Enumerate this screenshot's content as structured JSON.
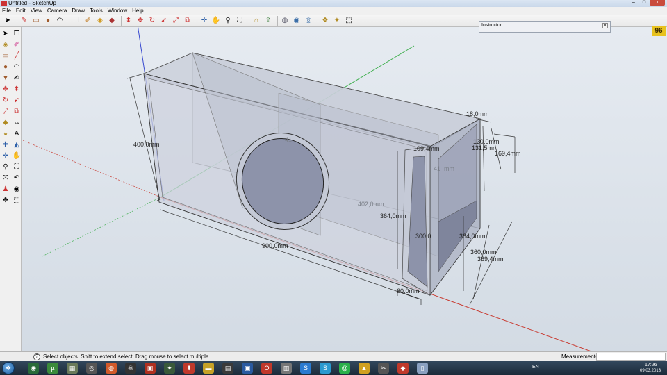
{
  "window": {
    "title": "Untitled - SketchUp",
    "minimize": "–",
    "maximize": "□",
    "close": "x"
  },
  "menu": [
    "File",
    "Edit",
    "View",
    "Camera",
    "Draw",
    "Tools",
    "Window",
    "Help"
  ],
  "instructor": {
    "title": "Instructor",
    "close": "x"
  },
  "badge": "96",
  "dimensions": {
    "height_left": "400,0mm",
    "length_bottom": "900,0mm",
    "inner_height": "364,0mm",
    "width_bottom": "60,0mm",
    "right_height_1": "360,0mm",
    "right_height_2": "369,4mm",
    "top_width": "18,0mm",
    "top_right_1": "130,0mm",
    "top_right_2": "131,5mm",
    "top_right_3": "169,4mm",
    "panel_width": "109,4mm",
    "inner_label_1": "41",
    "inner_label_2": "41",
    "inner_label_3": "mm",
    "inner_depth": "402,0mm",
    "inner_small_1": "300,0",
    "inner_small_2": "364,0mm"
  },
  "status": {
    "hint": "Select objects. Shift to extend select. Drag mouse to select multiple.",
    "measurements_label": "Measurements",
    "measurements_value": ""
  },
  "tray": {
    "lang": "EN",
    "time": "17:26",
    "date": "09.03.2013"
  },
  "colors": {
    "axis_red": "#c8392f",
    "axis_green": "#3cae4b",
    "axis_blue": "#3a4bd0",
    "box_face": "#c9ceda",
    "box_dark": "#9da3b6",
    "port_fill": "#8d93aa"
  }
}
